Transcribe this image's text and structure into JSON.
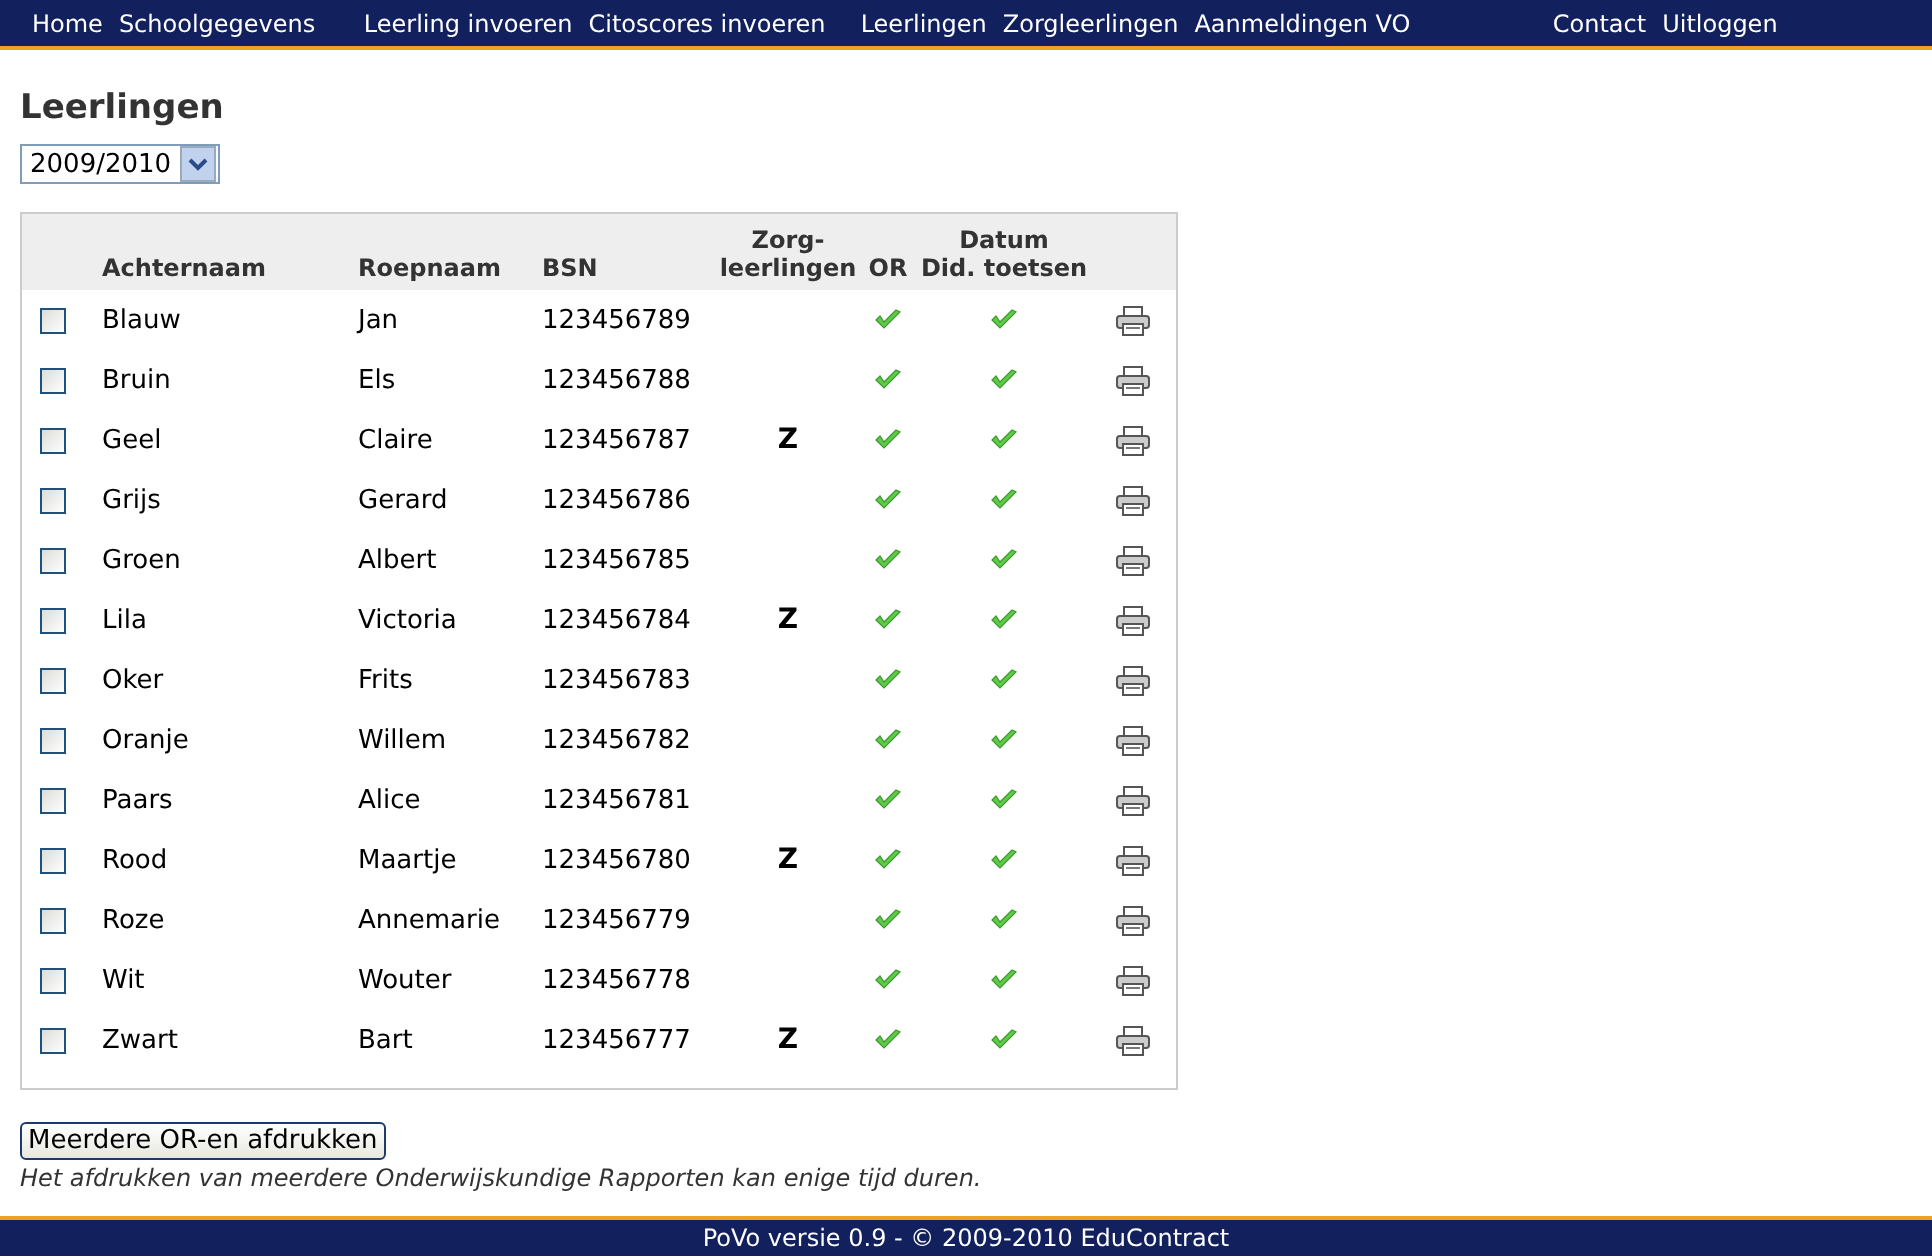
{
  "nav": [
    [
      "Home",
      "Schoolgegevens"
    ],
    [
      "Leerling invoeren",
      "Citoscores invoeren"
    ],
    [
      "Leerlingen",
      "Zorgleerlingen",
      "Aanmeldingen VO"
    ],
    [
      "Contact",
      "Uitloggen"
    ]
  ],
  "title": "Leerlingen",
  "year_select": {
    "value": "2009/2010"
  },
  "table": {
    "columns": [
      "Achternaam",
      "Roepnaam",
      "BSN",
      [
        "Zorg-",
        "leerlingen"
      ],
      "OR",
      [
        "Datum",
        "Did. toetsen"
      ]
    ],
    "rows": [
      {
        "checked": false,
        "achternaam": "Blauw",
        "roepnaam": "Jan",
        "bsn": "123456789",
        "or_done": true,
        "did_done": true
      },
      {
        "checked": false,
        "achternaam": "Bruin",
        "roepnaam": "Els",
        "bsn": "123456788",
        "or_done": true,
        "did_done": true
      },
      {
        "checked": false,
        "achternaam": "Geel",
        "roepnaam": "Claire",
        "bsn": "123456787",
        "zorg": "Z",
        "or_done": true,
        "did_done": true
      },
      {
        "checked": false,
        "achternaam": "Grijs",
        "roepnaam": "Gerard",
        "bsn": "123456786",
        "or_done": true,
        "did_done": true
      },
      {
        "checked": false,
        "achternaam": "Groen",
        "roepnaam": "Albert",
        "bsn": "123456785",
        "or_done": true,
        "did_done": true
      },
      {
        "checked": false,
        "achternaam": "Lila",
        "roepnaam": "Victoria",
        "bsn": "123456784",
        "zorg": "Z",
        "or_done": true,
        "did_done": true
      },
      {
        "checked": false,
        "achternaam": "Oker",
        "roepnaam": "Frits",
        "bsn": "123456783",
        "or_done": true,
        "did_done": true
      },
      {
        "checked": false,
        "achternaam": "Oranje",
        "roepnaam": "Willem",
        "bsn": "123456782",
        "or_done": true,
        "did_done": true
      },
      {
        "checked": false,
        "achternaam": "Paars",
        "roepnaam": "Alice",
        "bsn": "123456781",
        "or_done": true,
        "did_done": true
      },
      {
        "checked": false,
        "achternaam": "Rood",
        "roepnaam": "Maartje",
        "bsn": "123456780",
        "zorg": "Z",
        "or_done": true,
        "did_done": true
      },
      {
        "checked": false,
        "achternaam": "Roze",
        "roepnaam": "Annemarie",
        "bsn": "123456779",
        "or_done": true,
        "did_done": true
      },
      {
        "checked": false,
        "achternaam": "Wit",
        "roepnaam": "Wouter",
        "bsn": "123456778",
        "or_done": true,
        "did_done": true
      },
      {
        "checked": false,
        "achternaam": "Zwart",
        "roepnaam": "Bart",
        "bsn": "123456777",
        "zorg": "Z",
        "or_done": true,
        "did_done": true
      }
    ]
  },
  "print_button": "Meerdere OR-en afdrukken",
  "note": "Het afdrukken van meerdere Onderwijskundige Rapporten kan enige tijd duren.",
  "footer": "PoVo versie 0.9 - © 2009-2010 EduContract"
}
